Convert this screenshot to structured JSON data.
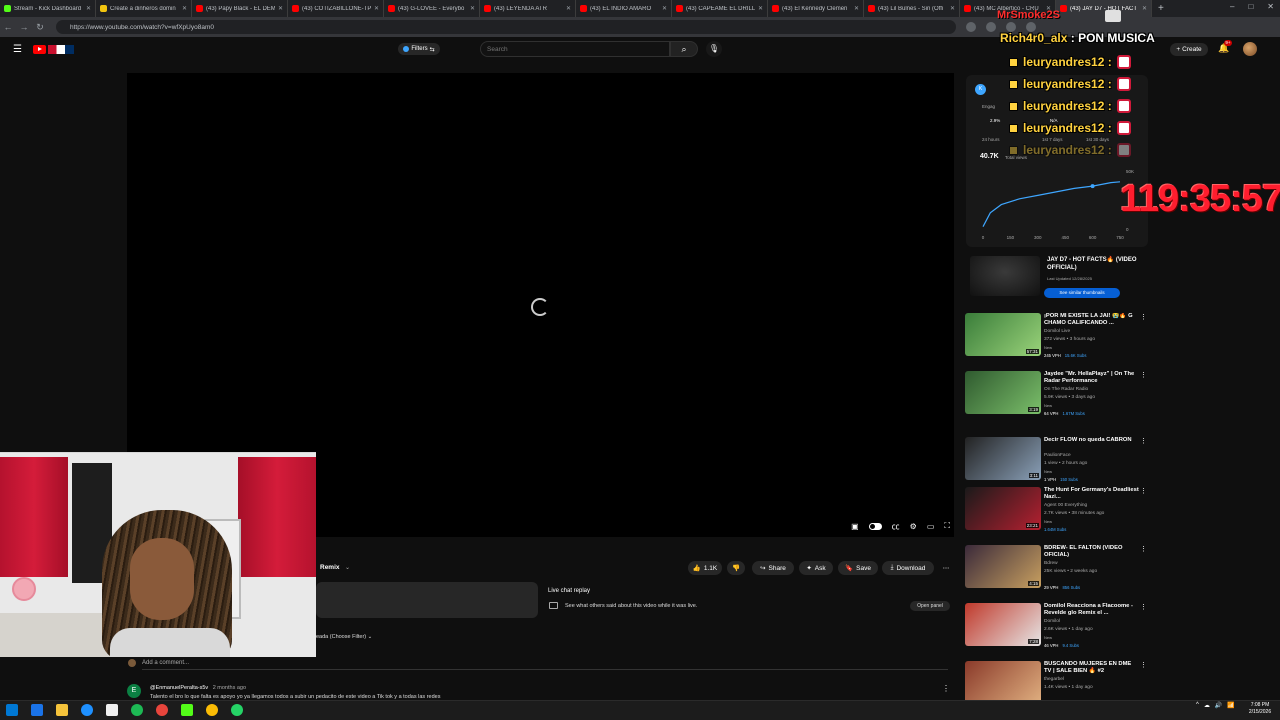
{
  "browser": {
    "tabs": [
      {
        "label": "Stream - Kick Dashboard",
        "color": "#53fc18"
      },
      {
        "label": "Create a dinheros domin",
        "color": "#f1c40f"
      },
      {
        "label": "(43) Papy Black - EL DEM",
        "color": "#ff0000"
      },
      {
        "label": "(43) COTIZABILLONE-TP",
        "color": "#ff0000"
      },
      {
        "label": "(43) G-LOVEE - Everybo",
        "color": "#ff0000"
      },
      {
        "label": "(43) LEYENDA ATR",
        "color": "#ff0000"
      },
      {
        "label": "(43) EL INDIO AMARO",
        "color": "#ff0000"
      },
      {
        "label": "(43) CAPEAME EL DRILL",
        "color": "#ff0000"
      },
      {
        "label": "(43) El Kennedy Clemen",
        "color": "#ff0000"
      },
      {
        "label": "(43) Lil Bulnes - Sin (Offi",
        "color": "#ff0000"
      },
      {
        "label": "(43) MC Albertico - CRU",
        "color": "#ff0000"
      },
      {
        "label": "(43) JAY D7 - HOT FACT",
        "color": "#ff0000"
      }
    ],
    "new_tab": "+",
    "window_controls": [
      "–",
      "□",
      "✕"
    ],
    "url": "https://www.youtube.com/watch?v=wfXpUyo8am0"
  },
  "header": {
    "filters_label": "Filters",
    "search_placeholder": "Search",
    "create_label": "Create",
    "notif_count": "9+"
  },
  "player": {
    "controls": [
      "autoplay-toggle",
      "subtitles",
      "settings",
      "miniplayer",
      "theater",
      "fullscreen"
    ]
  },
  "actions": {
    "remix": "Remix",
    "likes": "1.1K",
    "share": "Share",
    "ask": "Ask",
    "save": "Save",
    "download": "Download"
  },
  "live_chat": {
    "title": "Live chat replay",
    "desc": "See what others said about this video while it was live.",
    "open_panel": "Open panel"
  },
  "comments": {
    "sort": "eada (Choose Filter)",
    "add_placeholder": "Add a comment...",
    "first": {
      "avatar_letter": "E",
      "handle": "@EnmanuelPeralta-s5v",
      "time": "2 months ago",
      "text": "Talento el bro lo que falta es apoyo yo ya llegamos todos a subir un pedacito de este video a Tik tok y a todas las redes"
    }
  },
  "stats": {
    "k_badge": "K",
    "engage_label": "Engag",
    "pct": "2.9%",
    "na": "N/A",
    "hours": "24 hours",
    "week": "1st 7 days",
    "days": "1st 30 days",
    "views": "40.7K",
    "views_label": "Total views",
    "chart_data": {
      "type": "line",
      "x_ticks": [
        "0",
        "150",
        "300",
        "450",
        "600",
        "750"
      ],
      "y_ticks": [
        "0",
        "50K"
      ],
      "ylim": [
        0,
        50000
      ],
      "xlim": [
        0,
        750
      ],
      "points": [
        [
          0,
          2000
        ],
        [
          40,
          14000
        ],
        [
          100,
          21000
        ],
        [
          200,
          26000
        ],
        [
          300,
          29000
        ],
        [
          400,
          32000
        ],
        [
          500,
          35000
        ],
        [
          600,
          37000
        ],
        [
          700,
          40000
        ],
        [
          750,
          40700
        ]
      ],
      "color": "#3ea6ff"
    }
  },
  "featured": {
    "title": "JAY D7 - HOT FACTS🔥 (VIDEO OFFICIAL)",
    "updated": "Last Updated 12/28/2025",
    "button": "See similar thumbnails"
  },
  "recommendations": [
    {
      "title": "¡POR MI EXISTE LA JAI! 😭🔥 G CHAMO CALIFICANDO ...",
      "channel": "Domilol Live",
      "meta": "372 views • 3 hours ago",
      "badge": "New",
      "duration": "57:31",
      "vph": "245 VPH",
      "subs": "15.6K Subs",
      "colors": [
        "#3a7d3a",
        "#9ad37a"
      ]
    },
    {
      "title": "Jaydee \"Mr. HellaPlayz\" | On The Radar Performance",
      "channel": "On The Radar Radio",
      "meta": "5.9K views • 3 days ago",
      "badge": "New",
      "duration": "3:19",
      "vph": "64 VPH",
      "subs": "1.67M Subs",
      "colors": [
        "#2f5a2f",
        "#7bbf6a"
      ]
    },
    {
      "title": "Decir FLOW no queda CABRÓN",
      "channel": "PaulionFace",
      "meta": "1 view • 2 hours ago",
      "badge": "New",
      "duration": "3:11",
      "vph": "1 VPH",
      "subs": "150 Subs",
      "colors": [
        "#222",
        "#8aa0b8"
      ]
    },
    {
      "title": "The Hunt For Germany's Deadliest Nazi...",
      "channel": "Agent 00 Everything",
      "meta": "2.7K views • 38 minutes ago",
      "badge": "New",
      "duration": "23:21",
      "vph": "",
      "subs": "1.64M Subs",
      "colors": [
        "#1a1a1a",
        "#b52030"
      ]
    },
    {
      "title": "BDREW- EL FALTON (VIDEO OFICIAL)",
      "channel": "Bdrew",
      "meta": "25K views • 2 weeks ago",
      "badge": "",
      "duration": "4:15",
      "vph": "29 VPH",
      "subs": "856 Subs",
      "colors": [
        "#3b2a3a",
        "#c8a060"
      ]
    },
    {
      "title": "Domilol Reacciona a Flacoome - Revelde glo Remix el ...",
      "channel": "Domilol",
      "meta": "2.6K views • 1 day ago",
      "badge": "New",
      "duration": "7:28",
      "vph": "46 VPH",
      "subs": "9.4 Subs",
      "colors": [
        "#c0392b",
        "#e6e6e6"
      ]
    },
    {
      "title": "BUSCANDO MUJERES EN DME TV | SALE BIEN 🔥 #2",
      "channel": "thegarbel",
      "meta": "1.4K views • 1 day ago",
      "badge": "",
      "duration": "",
      "vph": "",
      "subs": "",
      "colors": [
        "#8a3a2a",
        "#e0b080"
      ]
    }
  ],
  "chat_overlay": {
    "top_user": "MrSmoke2S",
    "line1_user": "Rich4r0_alx",
    "line1_text": ": PON MUSICA",
    "repeat_user": "leuryandres12 :",
    "timer": "119:35:57"
  },
  "taskbar": {
    "tray_icons": [
      "^",
      "☁",
      "🔊",
      "📶"
    ],
    "time": "7:08 PM",
    "date": "2/15/2026"
  }
}
